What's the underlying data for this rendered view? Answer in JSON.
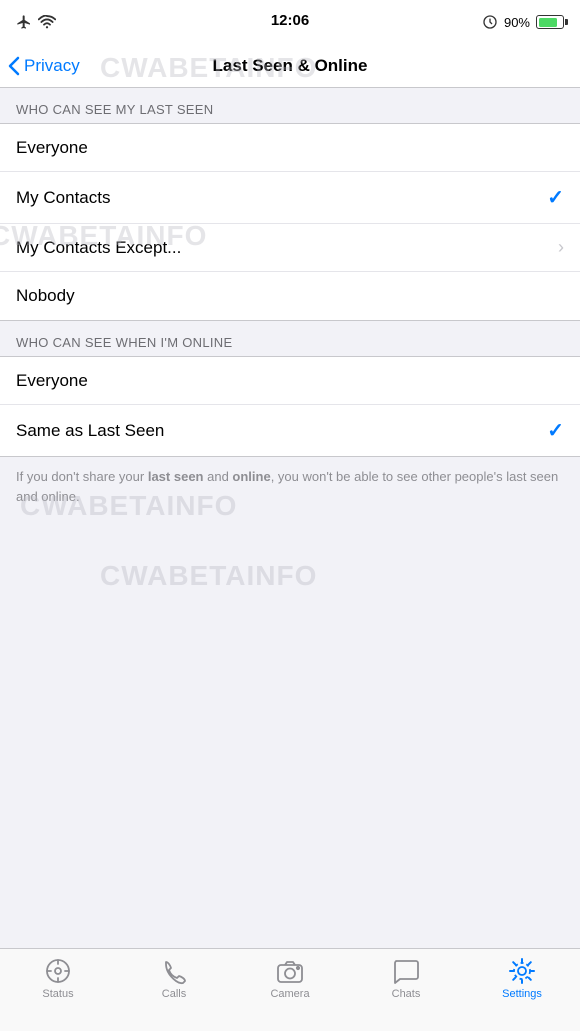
{
  "statusBar": {
    "time": "12:06",
    "battery": "90%"
  },
  "navBar": {
    "backLabel": "Privacy",
    "title": "Last Seen & Online"
  },
  "watermarks": [
    "CWABETAINFO",
    "CWABETAINFO",
    "CWABETAINFO",
    "CWABETAINFO"
  ],
  "lastSeenSection": {
    "header": "WHO CAN SEE MY LAST SEEN",
    "items": [
      {
        "label": "Everyone",
        "checked": false,
        "hasChevron": false
      },
      {
        "label": "My Contacts",
        "checked": true,
        "hasChevron": false
      },
      {
        "label": "My Contacts Except...",
        "checked": false,
        "hasChevron": true
      },
      {
        "label": "Nobody",
        "checked": false,
        "hasChevron": false
      }
    ]
  },
  "onlineSection": {
    "header": "WHO CAN SEE WHEN I'M ONLINE",
    "items": [
      {
        "label": "Everyone",
        "checked": false,
        "hasChevron": false
      },
      {
        "label": "Same as Last Seen",
        "checked": true,
        "hasChevron": false
      }
    ]
  },
  "infoText": {
    "before": "If you don't share your ",
    "bold1": "last seen",
    "middle": " and ",
    "bold2": "online",
    "after": ", you won't be able to see other people's last seen and online."
  },
  "tabBar": {
    "items": [
      {
        "label": "Status",
        "icon": "status-icon",
        "active": false
      },
      {
        "label": "Calls",
        "icon": "calls-icon",
        "active": false
      },
      {
        "label": "Camera",
        "icon": "camera-icon",
        "active": false
      },
      {
        "label": "Chats",
        "icon": "chats-icon",
        "active": false
      },
      {
        "label": "Settings",
        "icon": "settings-icon",
        "active": true
      }
    ]
  }
}
